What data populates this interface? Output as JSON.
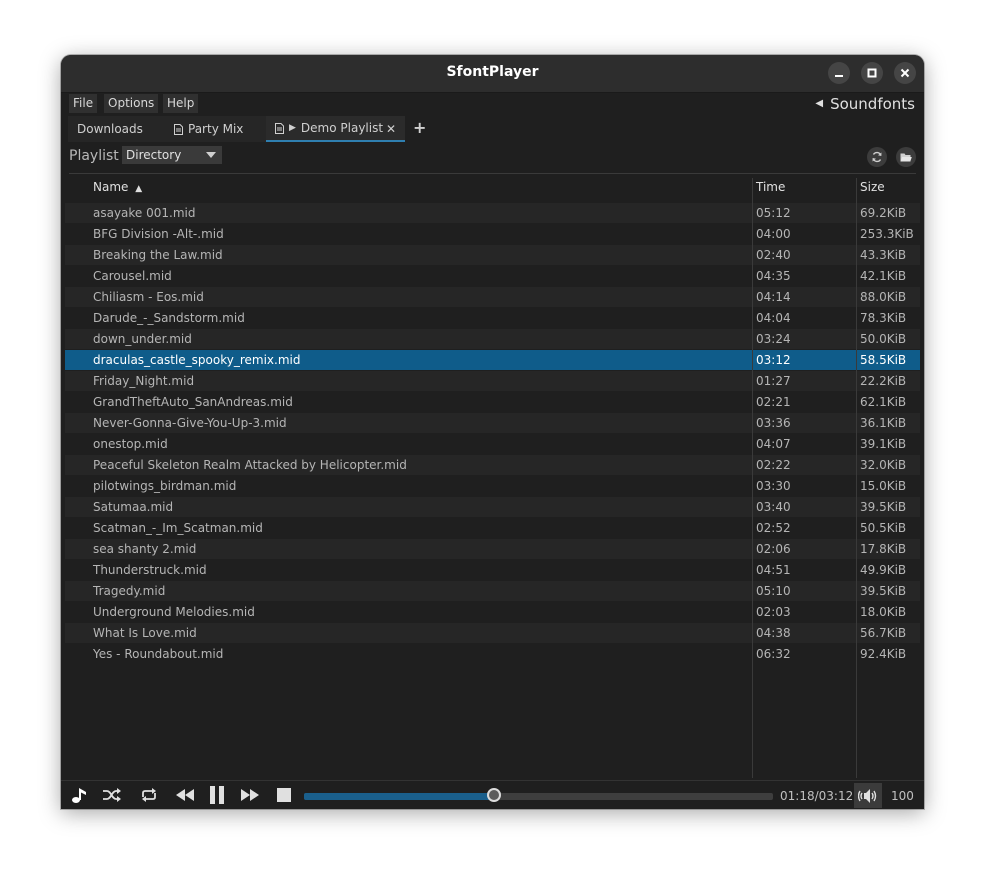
{
  "window": {
    "title": "SfontPlayer"
  },
  "menu": {
    "items": [
      "File",
      "Options",
      "Help"
    ],
    "soundfonts": "Soundfonts"
  },
  "tabs": [
    {
      "label": "Downloads",
      "icon": "none"
    },
    {
      "label": "Party Mix",
      "icon": "document-icon"
    },
    {
      "label": "Demo Playlist",
      "icon": "document-icon",
      "playing": true,
      "active": true,
      "closable": true
    }
  ],
  "toolbar": {
    "playlist_label": "Playlist",
    "source": "Directory"
  },
  "table": {
    "columns": {
      "name": "Name",
      "time": "Time",
      "size": "Size"
    },
    "sort_column": "Name",
    "sort_direction": "ascending",
    "rows": [
      {
        "name": "asayake 001.mid",
        "time": "05:12",
        "size": "69.2KiB"
      },
      {
        "name": "BFG Division -Alt-.mid",
        "time": "04:00",
        "size": "253.3KiB"
      },
      {
        "name": "Breaking the Law.mid",
        "time": "02:40",
        "size": "43.3KiB"
      },
      {
        "name": "Carousel.mid",
        "time": "04:35",
        "size": "42.1KiB"
      },
      {
        "name": "Chiliasm - Eos.mid",
        "time": "04:14",
        "size": "88.0KiB"
      },
      {
        "name": "Darude_-_Sandstorm.mid",
        "time": "04:04",
        "size": "78.3KiB"
      },
      {
        "name": "down_under.mid",
        "time": "03:24",
        "size": "50.0KiB"
      },
      {
        "name": "draculas_castle_spooky_remix.mid",
        "time": "03:12",
        "size": "58.5KiB",
        "selected": true
      },
      {
        "name": "Friday_Night.mid",
        "time": "01:27",
        "size": "22.2KiB"
      },
      {
        "name": "GrandTheftAuto_SanAndreas.mid",
        "time": "02:21",
        "size": "62.1KiB"
      },
      {
        "name": "Never-Gonna-Give-You-Up-3.mid",
        "time": "03:36",
        "size": "36.1KiB"
      },
      {
        "name": "onestop.mid",
        "time": "04:07",
        "size": "39.1KiB"
      },
      {
        "name": "Peaceful Skeleton Realm Attacked by Helicopter.mid",
        "time": "02:22",
        "size": "32.0KiB"
      },
      {
        "name": "pilotwings_birdman.mid",
        "time": "03:30",
        "size": "15.0KiB"
      },
      {
        "name": "Satumaa.mid",
        "time": "03:40",
        "size": "39.5KiB"
      },
      {
        "name": "Scatman_-_Im_Scatman.mid",
        "time": "02:52",
        "size": "50.5KiB"
      },
      {
        "name": "sea shanty 2.mid",
        "time": "02:06",
        "size": "17.8KiB"
      },
      {
        "name": "Thunderstruck.mid",
        "time": "04:51",
        "size": "49.9KiB"
      },
      {
        "name": "Tragedy.mid",
        "time": "05:10",
        "size": "39.5KiB"
      },
      {
        "name": "Underground Melodies.mid",
        "time": "02:03",
        "size": "18.0KiB"
      },
      {
        "name": "What Is Love.mid",
        "time": "04:38",
        "size": "56.7KiB"
      },
      {
        "name": "Yes - Roundabout.mid",
        "time": "06:32",
        "size": "92.4KiB"
      }
    ]
  },
  "player": {
    "time_display": "01:18/03:12",
    "progress_fraction": 0.406,
    "volume": "100",
    "state": "playing"
  },
  "colors": {
    "selection": "#0f5c8a",
    "progress": "#1a5f8c",
    "accent_tab": "#2f7fb0"
  }
}
